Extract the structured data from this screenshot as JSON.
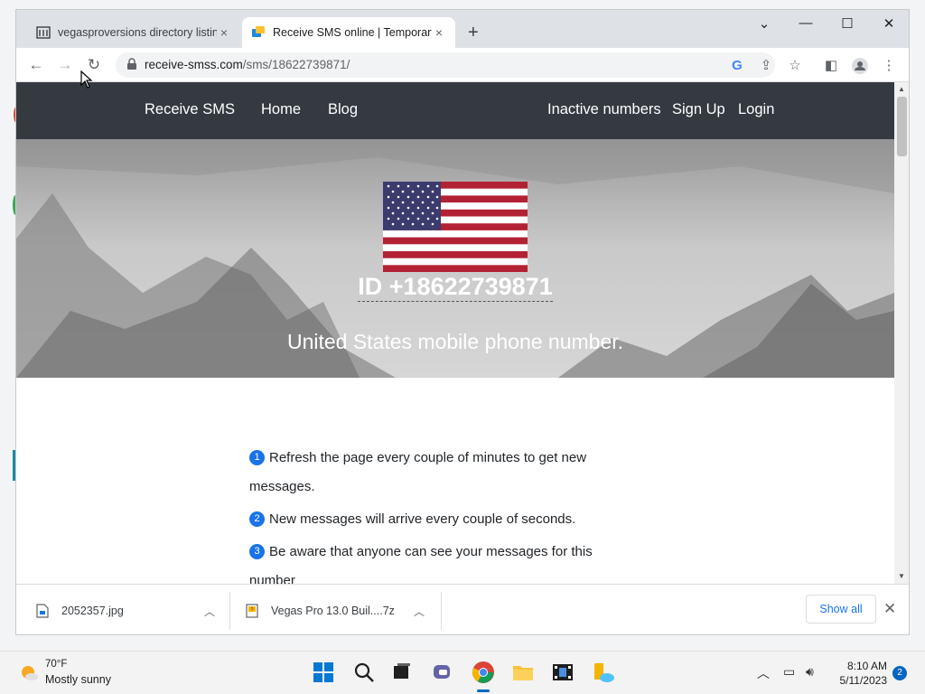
{
  "tabs": [
    {
      "title": "vegasproversions directory listing",
      "close": "×"
    },
    {
      "title": "Receive SMS online | Temporary",
      "close": "×"
    }
  ],
  "new_tab": "+",
  "window_controls": {
    "menu": "⌄",
    "minimize": "—",
    "maximize": "☐",
    "close": "✕"
  },
  "address_bar": {
    "domain": "receive-smss.com",
    "path": "/sms/18622739871/"
  },
  "site_nav": {
    "brand": "Receive SMS",
    "home": "Home",
    "blog": "Blog",
    "inactive": "Inactive numbers",
    "signup": "Sign Up",
    "login": "Login"
  },
  "hero": {
    "id_text": "ID +18622739871",
    "subtitle": "United States mobile phone number."
  },
  "steps": [
    {
      "num": "1",
      "text": "Refresh the page every couple of minutes to get new messages."
    },
    {
      "num": "2",
      "text": "New messages will arrive every couple of seconds."
    },
    {
      "num": "3",
      "text": "Be aware that anyone can see your messages for this number"
    }
  ],
  "downloads": {
    "items": [
      {
        "name": "2052357.jpg"
      },
      {
        "name": "Vegas Pro 13.0 Buil....7z"
      }
    ],
    "show_all": "Show all"
  },
  "taskbar": {
    "weather_temp": "70°F",
    "weather_cond": "Mostly sunny",
    "time": "8:10 AM",
    "date": "5/11/2023",
    "notifications": "2"
  },
  "colors": {
    "site_nav_bg": "#343a40",
    "link_blue": "#1a73e8",
    "taskbar_accent": "#0067c0"
  }
}
